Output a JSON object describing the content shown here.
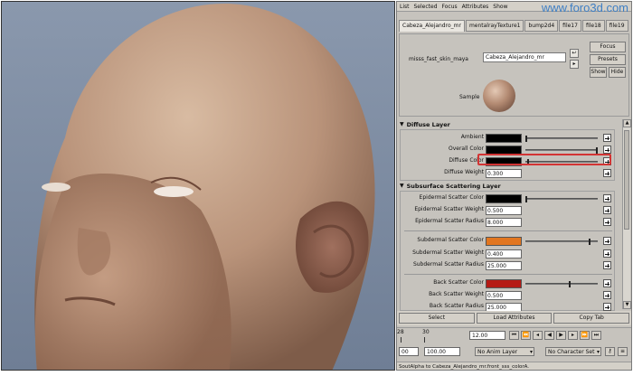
{
  "watermark": "www.foro3d.com",
  "menu": [
    "List",
    "Selected",
    "Focus",
    "Attributes",
    "Show"
  ],
  "tabs": [
    "Cabeza_Alejandro_mr",
    "mentalrayTexture1",
    "bump2d4",
    "file17",
    "file18",
    "file19"
  ],
  "node": {
    "type_label": "misss_fast_skin_maya",
    "name_value": "Cabeza_Alejandro_mr",
    "focus_label": "Focus",
    "presets_label": "Presets",
    "show_label": "Show",
    "hide_label": "Hide",
    "sample_label": "Sample"
  },
  "diffuse": {
    "title": "Diffuse Layer",
    "rows": [
      {
        "label": "Ambient",
        "kind": "color",
        "color": "#000000",
        "slider": 0.0
      },
      {
        "label": "Overall Color",
        "kind": "color",
        "color": "#000000",
        "slider": 1.0
      },
      {
        "label": "Diffuse Color",
        "kind": "color",
        "color": "#000000",
        "slider": 0.0
      },
      {
        "label": "Diffuse Weight",
        "kind": "number",
        "value": "0.300"
      }
    ]
  },
  "sss": {
    "title": "Subsurface Scattering Layer",
    "epidermal": [
      {
        "label": "Epidermal Scatter Color",
        "kind": "color",
        "color": "#000000",
        "slider": 0.0
      },
      {
        "label": "Epidermal Scatter Weight",
        "kind": "number",
        "value": "0.500"
      },
      {
        "label": "Epidermal Scatter Radius",
        "kind": "number",
        "value": "8.000"
      }
    ],
    "subdermal": [
      {
        "label": "Subdermal Scatter Color",
        "kind": "color",
        "color": "#e2761f",
        "slider": 0.88
      },
      {
        "label": "Subdermal Scatter Weight",
        "kind": "number",
        "value": "0.400"
      },
      {
        "label": "Subdermal Scatter Radius",
        "kind": "number",
        "value": "25.000"
      }
    ],
    "back": [
      {
        "label": "Back Scatter Color",
        "kind": "color",
        "color": "#b51a14",
        "slider": 0.6
      },
      {
        "label": "Back Scatter Weight",
        "kind": "number",
        "value": "0.500"
      },
      {
        "label": "Back Scatter Radius",
        "kind": "number",
        "value": "25.000"
      }
    ]
  },
  "bottom_buttons": [
    "Select",
    "Load Attributes",
    "Copy Tab"
  ],
  "timeline": {
    "tick_a": "28",
    "tick_b": "30",
    "current": "12.00"
  },
  "range": {
    "start": "00",
    "end": "100.00",
    "anim_layer": "No Anim Layer",
    "character": "No Character Set"
  },
  "status": "SoutAlpha to Cabeza_Alejandro_mr.front_sss_colorA."
}
